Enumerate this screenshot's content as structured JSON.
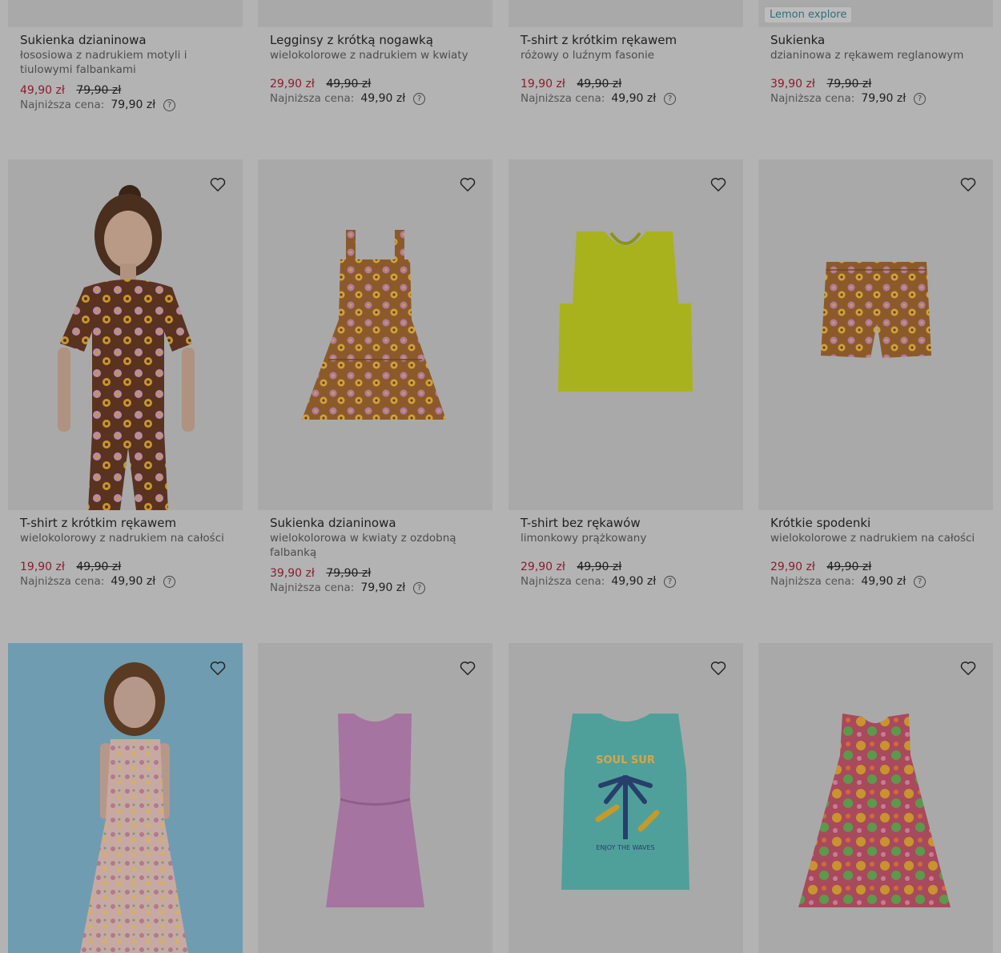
{
  "currency_note": "zł",
  "lowest_price_label": "Najniższa cena:",
  "help_icon": "question-circle-icon",
  "favorite_icon": "heart-outline-icon",
  "products": [
    {
      "title": "Sukienka dzianinowa",
      "subtitle": "łososiowa z nadrukiem motyli i tiulowymi falbankami",
      "price_now": "49,90 zł",
      "price_old": "79,90 zł",
      "lowest_price": "79,90 zł"
    },
    {
      "title": "Legginsy z krótką nogawką",
      "subtitle": "wielokolorowe z nadrukiem w kwiaty",
      "price_now": "29,90 zł",
      "price_old": "49,90 zł",
      "lowest_price": "49,90 zł"
    },
    {
      "title": "T-shirt z krótkim rękawem",
      "subtitle": "różowy o luźnym fasonie",
      "price_now": "19,90 zł",
      "price_old": "49,90 zł",
      "lowest_price": "49,90 zł"
    },
    {
      "title": "Sukienka",
      "subtitle": "dzianinowa z rękawem reglanowym",
      "price_now": "39,90 zł",
      "price_old": "79,90 zł",
      "lowest_price": "79,90 zł",
      "brand_tag": "Lemon explore"
    },
    {
      "title": "T-shirt z krótkim rękawem",
      "subtitle": "wielokolorowy z nadrukiem na całości",
      "price_now": "19,90 zł",
      "price_old": "49,90 zł",
      "lowest_price": "49,90 zł"
    },
    {
      "title": "Sukienka dzianinowa",
      "subtitle": "wielokolorowa w kwiaty z ozdobną falbanką",
      "price_now": "39,90 zł",
      "price_old": "79,90 zł",
      "lowest_price": "79,90 zł"
    },
    {
      "title": "T-shirt bez rękawów",
      "subtitle": "limonkowy prążkowany",
      "price_now": "29,90 zł",
      "price_old": "49,90 zł",
      "lowest_price": "49,90 zł"
    },
    {
      "title": "Krótkie spodenki",
      "subtitle": "wielokolorowe z nadrukiem na całości",
      "price_now": "29,90 zł",
      "price_old": "49,90 zł",
      "lowest_price": "49,90 zł"
    }
  ],
  "tshirt_print": {
    "top_text": "SOUL SUR",
    "bottom_text": "ENJOY THE WAVES"
  },
  "colors": {
    "price_sale": "#8a1d2e",
    "overlay_bg": "#b3b3b3",
    "brand_tag_text": "#2f6e7a"
  }
}
